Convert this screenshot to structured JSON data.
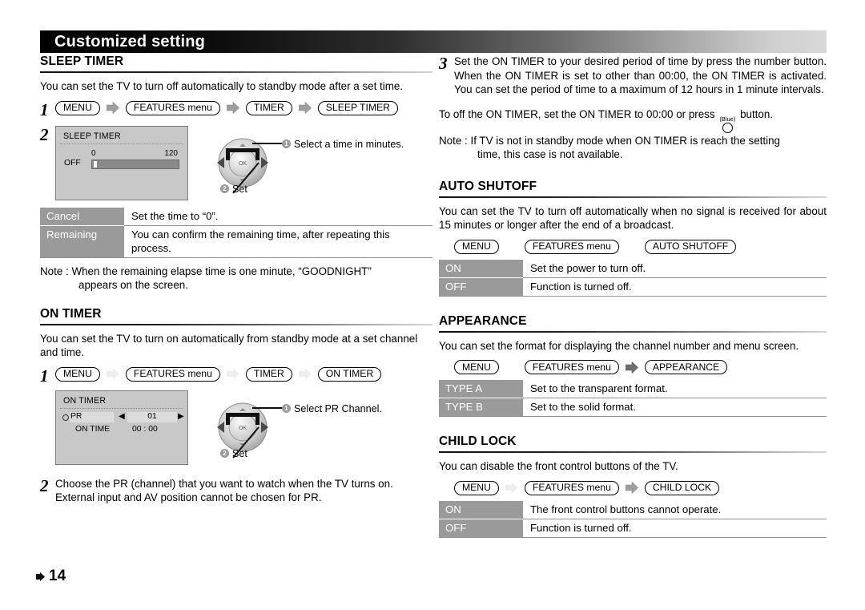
{
  "banner": {
    "title": "Customized setting"
  },
  "page": {
    "number": "14",
    "marker_icon": "right-arrow-icon"
  },
  "sleep_timer": {
    "heading": "SLEEP TIMER",
    "intro": "You can set the TV to turn off automatically to standby mode after a set time.",
    "step1_num": "1",
    "step1_buttons": [
      "MENU",
      "FEATURES menu",
      "TIMER",
      "SLEEP TIMER"
    ],
    "step2_num": "2",
    "osd": {
      "title": "SLEEP TIMER",
      "min": "0",
      "max": "120",
      "off_label": "OFF"
    },
    "callout1_index": "1",
    "callout1": "Select a time in minutes.",
    "callout2_index": "2",
    "callout2": "Set",
    "options": [
      {
        "key": "Cancel",
        "value": "Set the time to “0”."
      },
      {
        "key": "Remaining",
        "value": "You can confirm the remaining time, after repeating this process."
      }
    ],
    "note_label": "Note :",
    "note_line1": "When the remaining elapse time is one minute, “GOODNIGHT”",
    "note_line2": "appears on the screen."
  },
  "on_timer": {
    "heading": "ON TIMER",
    "intro": "You can set the TV to turn on automatically from standby mode at  a set channel and time.",
    "step1_num": "1",
    "step1_buttons": [
      "MENU",
      "FEATURES menu",
      "TIMER",
      "ON TIMER"
    ],
    "osd": {
      "title": "ON TIMER",
      "pr_label": "PR",
      "pr_value": "01",
      "left_arrow": "◀",
      "right_arrow": "▶",
      "time_label": "ON TIME",
      "time_value": "00 : 00"
    },
    "callout1_index": "1",
    "callout1": "Select PR Channel.",
    "callout2_index": "2",
    "callout2": "Set",
    "step2_num": "2",
    "step2_text": "Choose the PR (channel) that you want to watch when the TV turns on. External input and AV position cannot be chosen for PR."
  },
  "step3": {
    "num": "3",
    "text": "Set the ON TIMER to your desired period of time by press the number button. When the ON TIMER is set to other than 00:00, the ON TIMER is activated. You can set the period of time to a maximum of 12 hours in 1 minute intervals.",
    "off_line_a": "To off the ON TIMER, set the ON TIMER to 00:00 or press",
    "blue_label": "(Blue)",
    "off_line_b": "button.",
    "note_label": "Note :",
    "note_line1": "If TV is not in standby mode when ON TIMER is reach the setting",
    "note_line2": "time, this case is not available."
  },
  "auto_shutoff": {
    "heading": "AUTO SHUTOFF",
    "intro": "You can set the TV to turn off automatically when no signal is received for about 15 minutes or longer after the end of a broadcast.",
    "buttons": [
      "MENU",
      "FEATURES menu",
      "AUTO SHUTOFF"
    ],
    "options": [
      {
        "key": "ON",
        "value": "Set the power to turn off."
      },
      {
        "key": "OFF",
        "value": "Function is turned off."
      }
    ]
  },
  "appearance": {
    "heading": "APPEARANCE",
    "intro": "You can set the format for displaying the channel number and menu screen.",
    "buttons": [
      "MENU",
      "FEATURES menu",
      "APPEARANCE"
    ],
    "options": [
      {
        "key": "TYPE A",
        "value": "Set to the transparent format."
      },
      {
        "key": "TYPE B",
        "value": "Set to the solid format."
      }
    ]
  },
  "child_lock": {
    "heading": "CHILD LOCK",
    "intro": "You can disable the front control buttons of the TV.",
    "buttons": [
      "MENU",
      "FEATURES menu",
      "CHILD LOCK"
    ],
    "options": [
      {
        "key": "ON",
        "value": "The front control buttons cannot operate."
      },
      {
        "key": "OFF",
        "value": "Function is turned off."
      }
    ]
  }
}
